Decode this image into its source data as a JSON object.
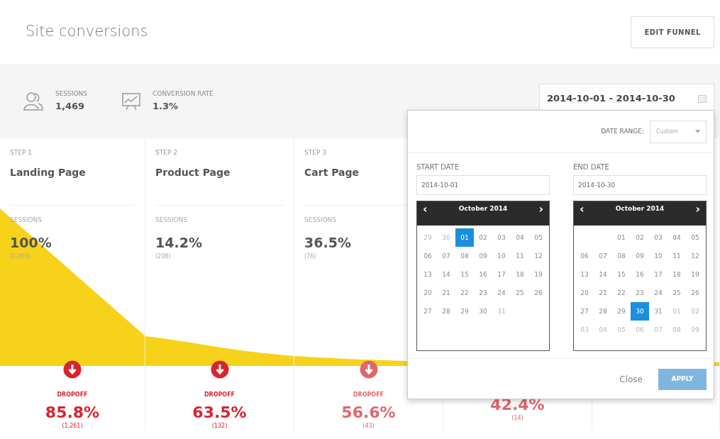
{
  "title": "Site conversions",
  "edit_button": "EDIT FUNNEL",
  "stats": [
    {
      "kind": "users",
      "label": "SESSIONS",
      "value": "1,469"
    },
    {
      "kind": "chart",
      "label": "CONVERSION RATE",
      "value": "1.3%"
    }
  ],
  "date_field": {
    "value": "2014-10-01 - 2014-10-30"
  },
  "steps": [
    {
      "step": "STEP 1",
      "name": "Landing Page",
      "metric": "SESSIONS",
      "percent": "100%",
      "count": "(1,469)"
    },
    {
      "step": "STEP 2",
      "name": "Product Page",
      "metric": "SESSIONS",
      "percent": "14.2%",
      "count": "(208)"
    },
    {
      "step": "STEP 3",
      "name": "Cart Page",
      "metric": "SESSIONS",
      "percent": "36.5%",
      "count": "(76)"
    }
  ],
  "dropoffs": [
    {
      "label": "DROPOFF",
      "percent": "85.8%",
      "count": "(1,261)",
      "color": "#d9232d"
    },
    {
      "label": "DROPOFF",
      "percent": "63.5%",
      "count": "(132)",
      "color": "#d9232d"
    },
    {
      "label": "DROPOFF",
      "percent": "56.6%",
      "count": "(43)",
      "color": "#e0666c"
    },
    {
      "percent": "42.4%",
      "count": "(14)",
      "color": "#e0666c"
    }
  ],
  "popup": {
    "range_label": "DATE RANGE:",
    "range_value": "Custom",
    "calendars": [
      {
        "label": "START DATE",
        "value": "2014-10-01",
        "month": "October 2014",
        "prev": "‹",
        "next": "›",
        "weeks": [
          [
            {
              "day": "29",
              "muted": true,
              "selected": false
            },
            {
              "day": "30",
              "muted": true,
              "selected": false
            },
            {
              "day": "01",
              "muted": false,
              "selected": true
            },
            {
              "day": "02",
              "muted": false,
              "selected": false
            },
            {
              "day": "03",
              "muted": false,
              "selected": false
            },
            {
              "day": "04",
              "muted": false,
              "selected": false
            },
            {
              "day": "05",
              "muted": false,
              "selected": false
            }
          ],
          [
            {
              "day": "06",
              "muted": false,
              "selected": false
            },
            {
              "day": "07",
              "muted": false,
              "selected": false
            },
            {
              "day": "08",
              "muted": false,
              "selected": false
            },
            {
              "day": "09",
              "muted": false,
              "selected": false
            },
            {
              "day": "10",
              "muted": false,
              "selected": false
            },
            {
              "day": "11",
              "muted": false,
              "selected": false
            },
            {
              "day": "12",
              "muted": false,
              "selected": false
            }
          ],
          [
            {
              "day": "13",
              "muted": false,
              "selected": false
            },
            {
              "day": "14",
              "muted": false,
              "selected": false
            },
            {
              "day": "15",
              "muted": false,
              "selected": false
            },
            {
              "day": "16",
              "muted": false,
              "selected": false
            },
            {
              "day": "17",
              "muted": false,
              "selected": false
            },
            {
              "day": "18",
              "muted": false,
              "selected": false
            },
            {
              "day": "19",
              "muted": false,
              "selected": false
            }
          ],
          [
            {
              "day": "20",
              "muted": false,
              "selected": false
            },
            {
              "day": "21",
              "muted": false,
              "selected": false
            },
            {
              "day": "22",
              "muted": false,
              "selected": false
            },
            {
              "day": "23",
              "muted": false,
              "selected": false
            },
            {
              "day": "24",
              "muted": false,
              "selected": false
            },
            {
              "day": "25",
              "muted": false,
              "selected": false
            },
            {
              "day": "26",
              "muted": false,
              "selected": false
            }
          ],
          [
            {
              "day": "27",
              "muted": false,
              "selected": false
            },
            {
              "day": "28",
              "muted": false,
              "selected": false
            },
            {
              "day": "29",
              "muted": false,
              "selected": false
            },
            {
              "day": "30",
              "muted": false,
              "selected": false
            },
            {
              "day": "31",
              "muted": true,
              "selected": false
            }
          ]
        ]
      },
      {
        "label": "END DATE",
        "value": "2014-10-30",
        "month": "October 2014",
        "prev": "‹",
        "next": "›",
        "weeks": [
          [
            {
              "kind": "blank"
            },
            {
              "kind": "blank"
            },
            {
              "day": "01",
              "muted": false,
              "selected": false
            },
            {
              "day": "02",
              "muted": false,
              "selected": false
            },
            {
              "day": "03",
              "muted": false,
              "selected": false
            },
            {
              "day": "04",
              "muted": false,
              "selected": false
            },
            {
              "day": "05",
              "muted": false,
              "selected": false
            }
          ],
          [
            {
              "day": "06",
              "muted": false,
              "selected": false
            },
            {
              "day": "07",
              "muted": false,
              "selected": false
            },
            {
              "day": "08",
              "muted": false,
              "selected": false
            },
            {
              "day": "09",
              "muted": false,
              "selected": false
            },
            {
              "day": "10",
              "muted": false,
              "selected": false
            },
            {
              "day": "11",
              "muted": false,
              "selected": false
            },
            {
              "day": "12",
              "muted": false,
              "selected": false
            }
          ],
          [
            {
              "day": "13",
              "muted": false,
              "selected": false
            },
            {
              "day": "14",
              "muted": false,
              "selected": false
            },
            {
              "day": "15",
              "muted": false,
              "selected": false
            },
            {
              "day": "16",
              "muted": false,
              "selected": false
            },
            {
              "day": "17",
              "muted": false,
              "selected": false
            },
            {
              "day": "18",
              "muted": false,
              "selected": false
            },
            {
              "day": "19",
              "muted": false,
              "selected": false
            }
          ],
          [
            {
              "day": "20",
              "muted": false,
              "selected": false
            },
            {
              "day": "21",
              "muted": false,
              "selected": false
            },
            {
              "day": "22",
              "muted": false,
              "selected": false
            },
            {
              "day": "23",
              "muted": false,
              "selected": false
            },
            {
              "day": "24",
              "muted": false,
              "selected": false
            },
            {
              "day": "25",
              "muted": false,
              "selected": false
            },
            {
              "day": "26",
              "muted": false,
              "selected": false
            }
          ],
          [
            {
              "day": "27",
              "muted": false,
              "selected": false
            },
            {
              "day": "28",
              "muted": false,
              "selected": false
            },
            {
              "day": "29",
              "muted": false,
              "selected": false
            },
            {
              "day": "30",
              "muted": false,
              "selected": true
            },
            {
              "day": "31",
              "muted": false,
              "selected": false
            },
            {
              "day": "01",
              "muted": true,
              "selected": false
            },
            {
              "day": "02",
              "muted": true,
              "selected": false
            }
          ],
          [
            {
              "day": "03",
              "muted": true,
              "selected": false
            },
            {
              "day": "04",
              "muted": true,
              "selected": false
            },
            {
              "day": "05",
              "muted": true,
              "selected": false
            },
            {
              "day": "06",
              "muted": true,
              "selected": false
            },
            {
              "day": "07",
              "muted": true,
              "selected": false
            },
            {
              "day": "08",
              "muted": true,
              "selected": false
            },
            {
              "day": "09",
              "muted": true,
              "selected": false
            }
          ]
        ]
      }
    ],
    "close": "Close",
    "apply": {
      "label": "APPLY",
      "disabled": true
    }
  }
}
